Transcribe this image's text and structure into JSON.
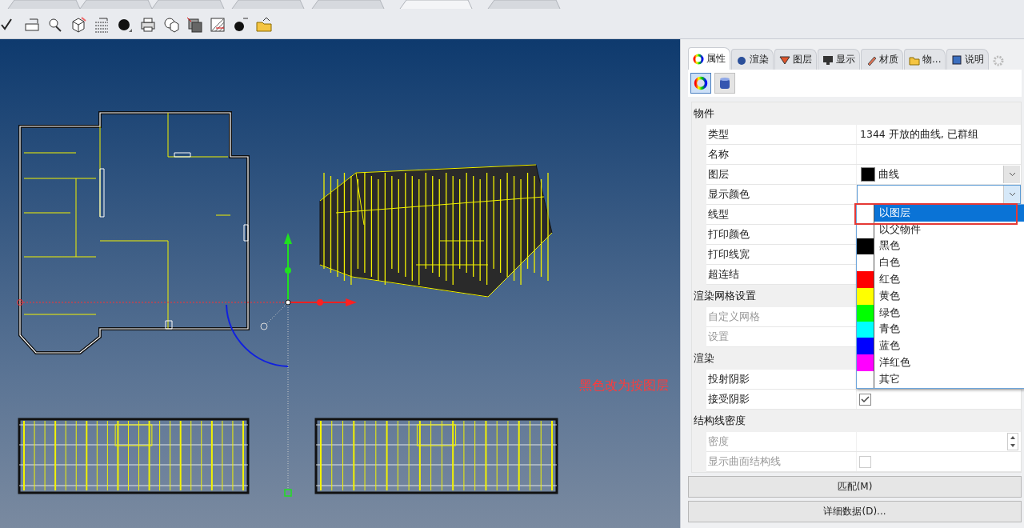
{
  "panel": {
    "tabs": [
      {
        "label": "属性",
        "selected": true
      },
      {
        "label": "渲染",
        "selected": false
      },
      {
        "label": "图层",
        "selected": false
      },
      {
        "label": "显示",
        "selected": false
      },
      {
        "label": "材质",
        "selected": false
      },
      {
        "label": "物...",
        "selected": false
      },
      {
        "label": "说明",
        "selected": false
      }
    ],
    "sub_tools": [
      {
        "selected": true
      },
      {
        "selected": false
      }
    ],
    "sections": [
      {
        "title": "物件",
        "rows": [
          {
            "label": "类型",
            "kind": "text",
            "value": "1344 开放的曲线, 已群组",
            "disabled": false
          },
          {
            "label": "名称",
            "kind": "text",
            "disabled": false
          },
          {
            "label": "图层",
            "kind": "combo",
            "value": "曲线",
            "color": "#000000",
            "expanded": false,
            "disabled": false
          },
          {
            "label": "显示颜色",
            "kind": "combo",
            "expanded": true,
            "disabled": false,
            "options": [
              {
                "label": "以图层",
                "color": "#ffffff",
                "selected": true
              },
              {
                "label": "以父物件",
                "color": "#ffffff",
                "selected": false
              },
              {
                "label": "黑色",
                "color": "#000000",
                "selected": false
              },
              {
                "label": "白色",
                "color": "#ffffff",
                "selected": false
              },
              {
                "label": "红色",
                "color": "#ff0000",
                "selected": false
              },
              {
                "label": "黄色",
                "color": "#ffff00",
                "selected": false
              },
              {
                "label": "绿色",
                "color": "#00ff00",
                "selected": false
              },
              {
                "label": "青色",
                "color": "#00ffff",
                "selected": false
              },
              {
                "label": "蓝色",
                "color": "#0000ff",
                "selected": false
              },
              {
                "label": "洋红色",
                "color": "#ff00ff",
                "selected": false
              },
              {
                "label": "其它",
                "color": "#ffffff",
                "selected": false
              }
            ]
          },
          {
            "label": "线型",
            "kind": "text",
            "disabled": false
          },
          {
            "label": "打印颜色",
            "kind": "text",
            "disabled": false
          },
          {
            "label": "打印线宽",
            "kind": "text",
            "disabled": false
          },
          {
            "label": "超连结",
            "kind": "text",
            "disabled": false
          }
        ]
      },
      {
        "title": "渲染网格设置",
        "rows": [
          {
            "label": "自定义网格",
            "kind": "text",
            "disabled": true
          },
          {
            "label": "设置",
            "kind": "text",
            "disabled": true
          }
        ]
      },
      {
        "title": "渲染",
        "rows": [
          {
            "label": "投射阴影",
            "kind": "text",
            "disabled": false
          },
          {
            "label": "接受阴影",
            "kind": "checkbox",
            "checked": true,
            "disabled": false
          }
        ]
      },
      {
        "title": "结构线密度",
        "rows": [
          {
            "label": "密度",
            "kind": "spinner",
            "disabled": true
          },
          {
            "label": "显示曲面结构线",
            "kind": "checkbox",
            "checked": false,
            "disabled": true
          }
        ]
      }
    ],
    "buttons": [
      "匹配(M)",
      "详细数据(D)..."
    ]
  },
  "viewport": {
    "annotation": "黑色改为按图层"
  }
}
